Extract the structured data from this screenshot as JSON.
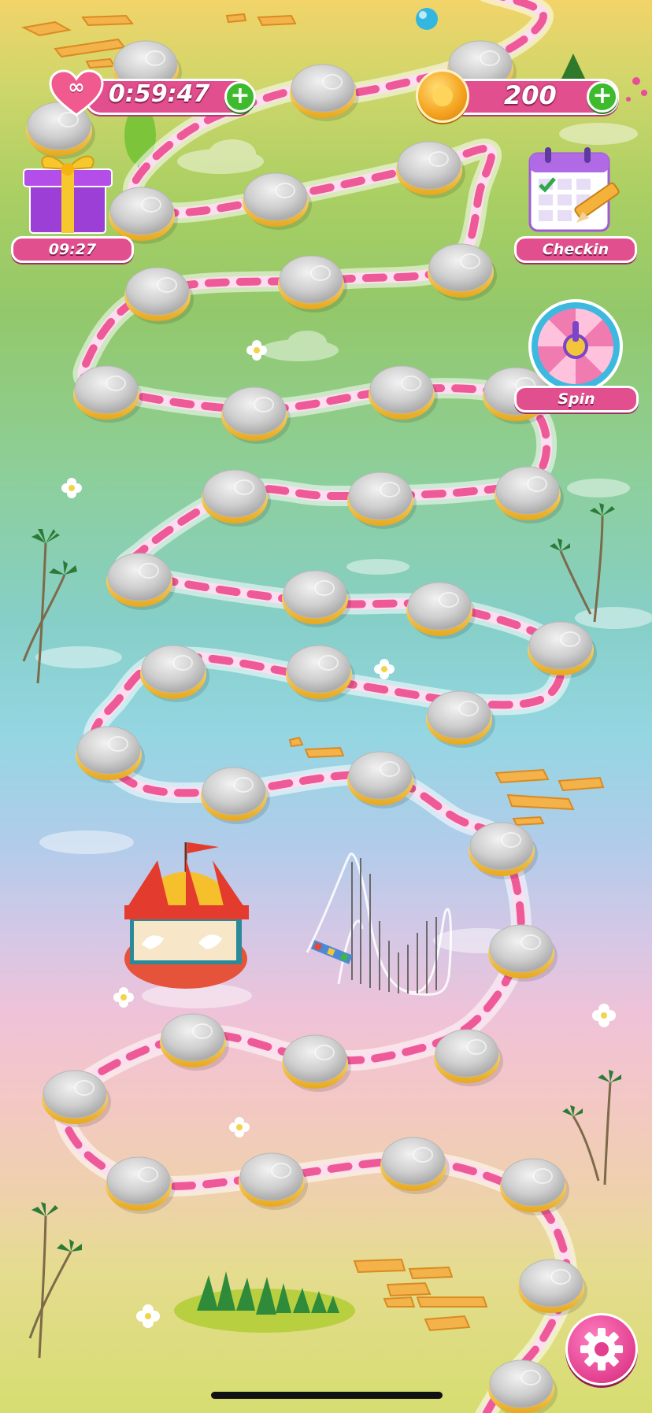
{
  "hud": {
    "lives_timer": "0:59:47",
    "coins": "200",
    "heart_symbol": "∞",
    "gift_timer": "09:27",
    "checkin_label": "Checkin",
    "spin_label": "Spin"
  },
  "icons": [
    "heart-infinity-icon",
    "plus-icon",
    "coin-icon",
    "gift-box-icon",
    "calendar-checkin-icon",
    "spin-wheel-icon",
    "settings-gear-icon"
  ],
  "colors": {
    "accent_pink": "#e14f8f",
    "plus_green": "#3dbb2d",
    "coin_gold": "#f5a623",
    "level_node_gray": "#c9c9c9",
    "level_node_rim": "#f5c93a",
    "path_stripe": "#ee5a97"
  },
  "level_nodes": [
    {
      "id": 1,
      "status": "locked"
    },
    {
      "id": 2,
      "status": "locked"
    },
    {
      "id": 3,
      "status": "locked"
    },
    {
      "id": 4,
      "status": "locked"
    },
    {
      "id": 5,
      "status": "locked"
    },
    {
      "id": 6,
      "status": "locked"
    },
    {
      "id": 7,
      "status": "locked"
    },
    {
      "id": 8,
      "status": "locked"
    },
    {
      "id": 9,
      "status": "locked"
    },
    {
      "id": 10,
      "status": "locked"
    },
    {
      "id": 11,
      "status": "locked"
    },
    {
      "id": 12,
      "status": "locked"
    },
    {
      "id": 13,
      "status": "locked"
    },
    {
      "id": 14,
      "status": "locked"
    },
    {
      "id": 15,
      "status": "locked"
    },
    {
      "id": 16,
      "status": "locked"
    },
    {
      "id": 17,
      "status": "locked"
    },
    {
      "id": 18,
      "status": "locked"
    },
    {
      "id": 19,
      "status": "locked"
    },
    {
      "id": 20,
      "status": "locked"
    },
    {
      "id": 21,
      "status": "locked"
    },
    {
      "id": 22,
      "status": "locked"
    },
    {
      "id": 23,
      "status": "locked"
    },
    {
      "id": 24,
      "status": "locked"
    },
    {
      "id": 25,
      "status": "locked"
    },
    {
      "id": 26,
      "status": "locked"
    },
    {
      "id": 27,
      "status": "locked"
    },
    {
      "id": 28,
      "status": "locked"
    },
    {
      "id": 29,
      "status": "locked"
    },
    {
      "id": 30,
      "status": "locked"
    },
    {
      "id": 31,
      "status": "locked"
    },
    {
      "id": 32,
      "status": "locked"
    },
    {
      "id": 33,
      "status": "locked"
    },
    {
      "id": 34,
      "status": "locked"
    },
    {
      "id": 35,
      "status": "locked"
    },
    {
      "id": 36,
      "status": "locked"
    },
    {
      "id": 37,
      "status": "locked"
    },
    {
      "id": 38,
      "status": "locked"
    },
    {
      "id": 39,
      "status": "locked"
    },
    {
      "id": 40,
      "status": "locked"
    },
    {
      "id": 41,
      "status": "locked"
    },
    {
      "id": 42,
      "status": "locked"
    },
    {
      "id": 43,
      "status": "locked"
    },
    {
      "id": 44,
      "status": "locked"
    },
    {
      "id": 45,
      "status": "locked"
    }
  ]
}
